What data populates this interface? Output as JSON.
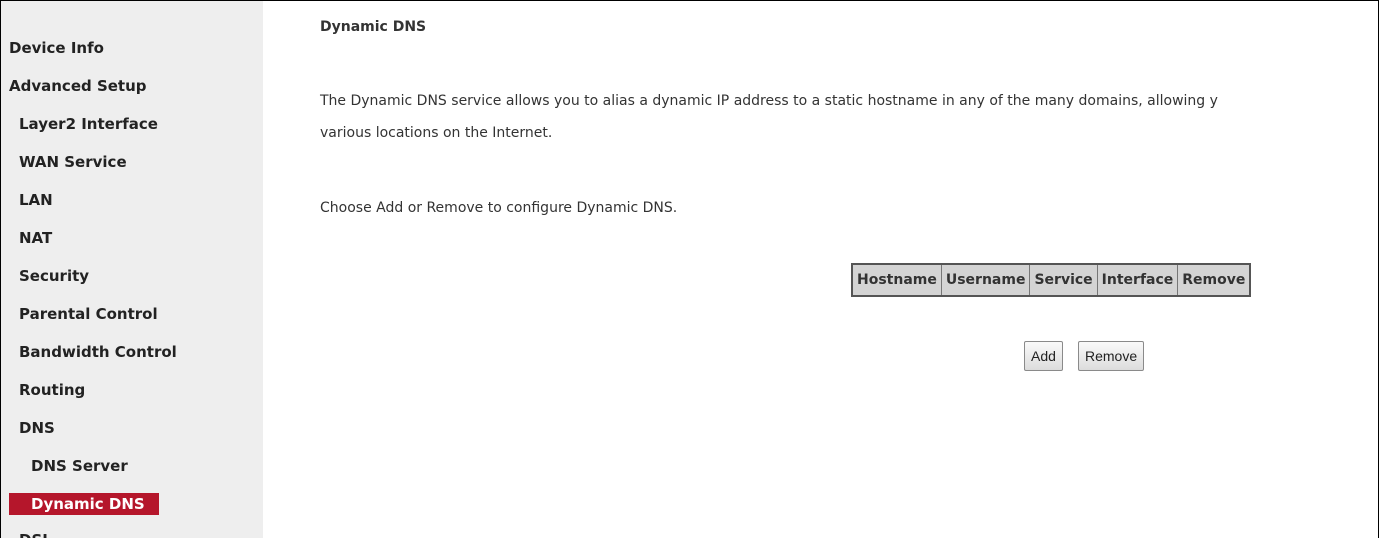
{
  "sidebar": {
    "items": [
      {
        "label": "Device Info"
      },
      {
        "label": "Advanced Setup"
      },
      {
        "label": "Layer2 Interface"
      },
      {
        "label": "WAN Service"
      },
      {
        "label": "LAN"
      },
      {
        "label": "NAT"
      },
      {
        "label": "Security"
      },
      {
        "label": "Parental Control"
      },
      {
        "label": "Bandwidth Control"
      },
      {
        "label": "Routing"
      },
      {
        "label": "DNS"
      },
      {
        "label": "DNS Server"
      },
      {
        "label": "Dynamic DNS"
      },
      {
        "label": "DSL"
      }
    ],
    "active_color": "#b5162b"
  },
  "main": {
    "title": "Dynamic DNS",
    "description_line1": "The Dynamic DNS service allows you to alias a dynamic IP address to a static hostname in any of the many domains, allowing y",
    "description_line2": "various locations on the Internet.",
    "instruction": "Choose Add or Remove to configure Dynamic DNS.",
    "table": {
      "headers": [
        "Hostname",
        "Username",
        "Service",
        "Interface",
        "Remove"
      ]
    },
    "buttons": {
      "add": "Add",
      "remove": "Remove"
    }
  }
}
